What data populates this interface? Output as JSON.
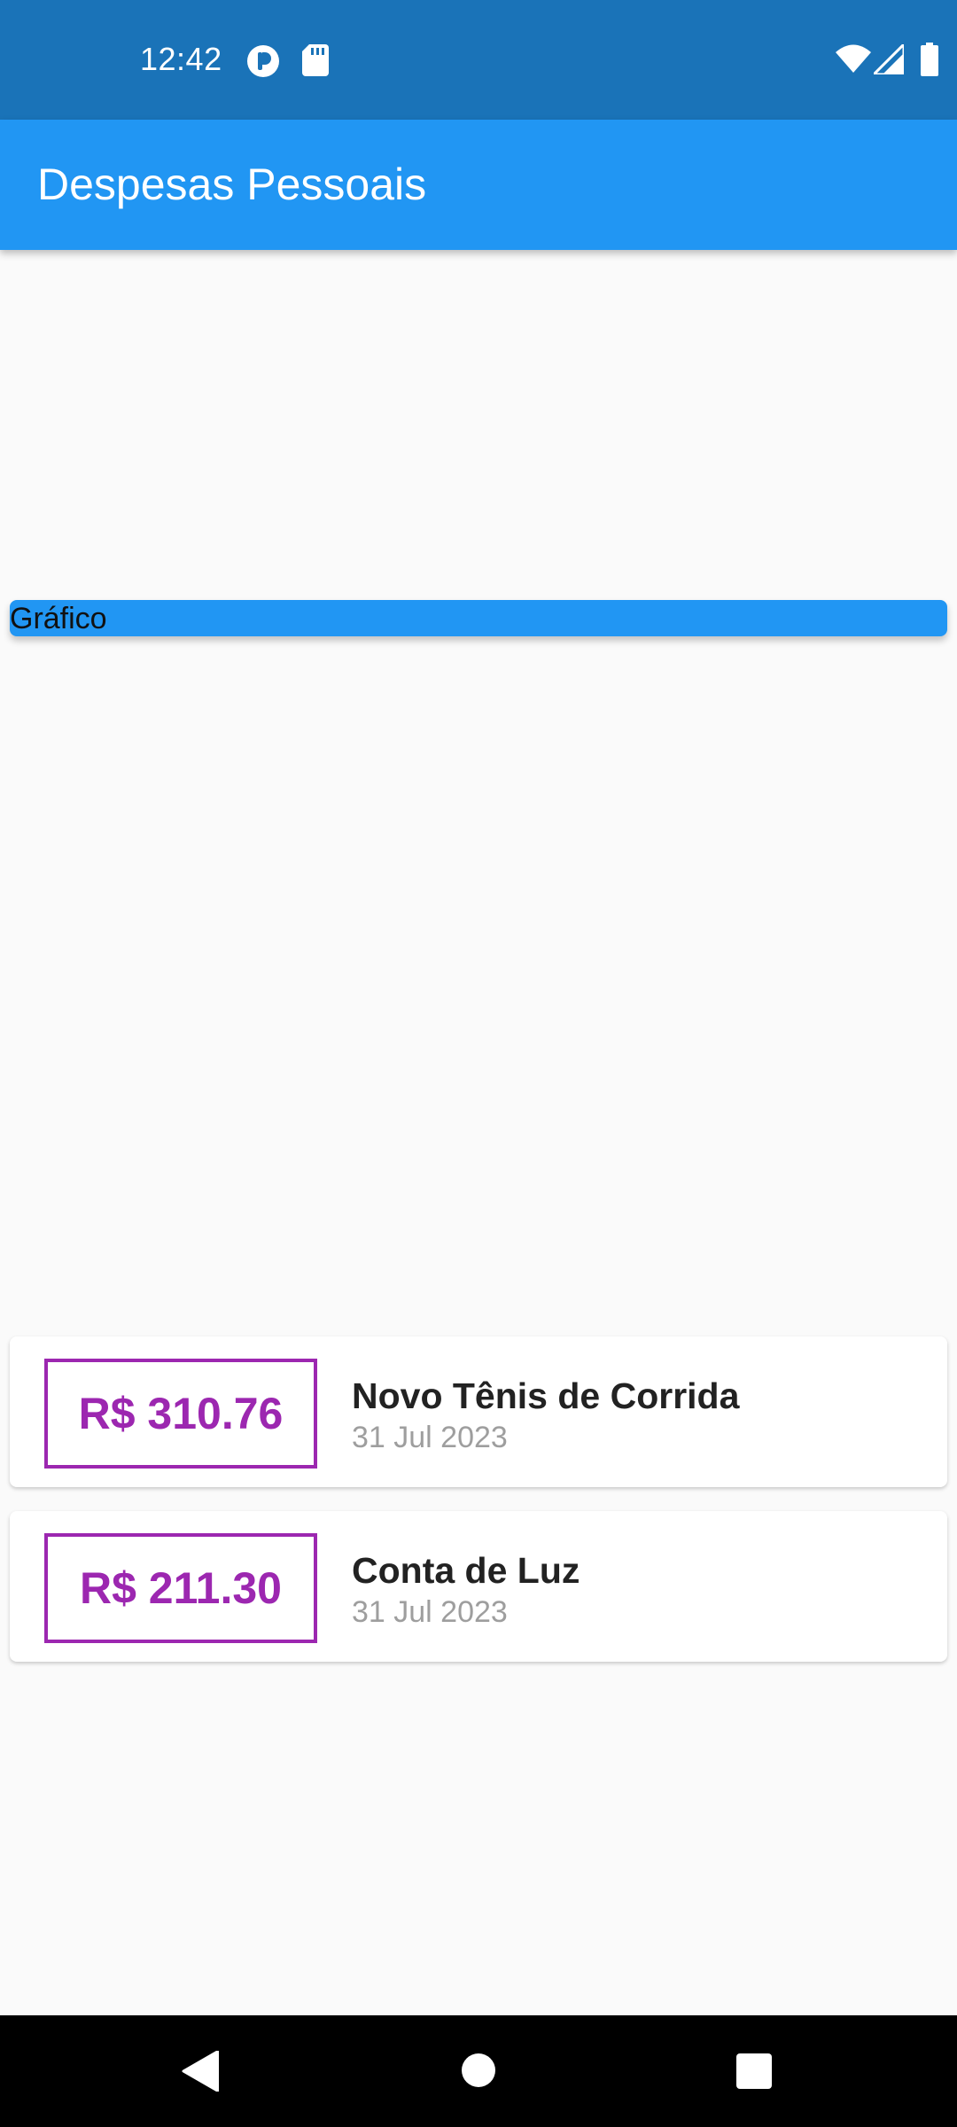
{
  "status_bar": {
    "time": "12:42",
    "icons": [
      "circle-p-icon",
      "sd-card-icon",
      "wifi-icon",
      "signal-icon",
      "battery-icon"
    ]
  },
  "app_bar": {
    "title": "Despesas Pessoais",
    "color": "#2196f3"
  },
  "chart_placeholder": {
    "label": "Gráfico"
  },
  "transactions": [
    {
      "value": "R$ 310.76",
      "title": "Novo Tênis de Corrida",
      "date": "31 Jul 2023"
    },
    {
      "value": "R$ 211.30",
      "title": "Conta de Luz",
      "date": "31 Jul 2023"
    }
  ],
  "accent_color": "#9c27b0",
  "nav_bar": {
    "buttons": [
      "back-icon",
      "home-icon",
      "recents-icon"
    ]
  }
}
